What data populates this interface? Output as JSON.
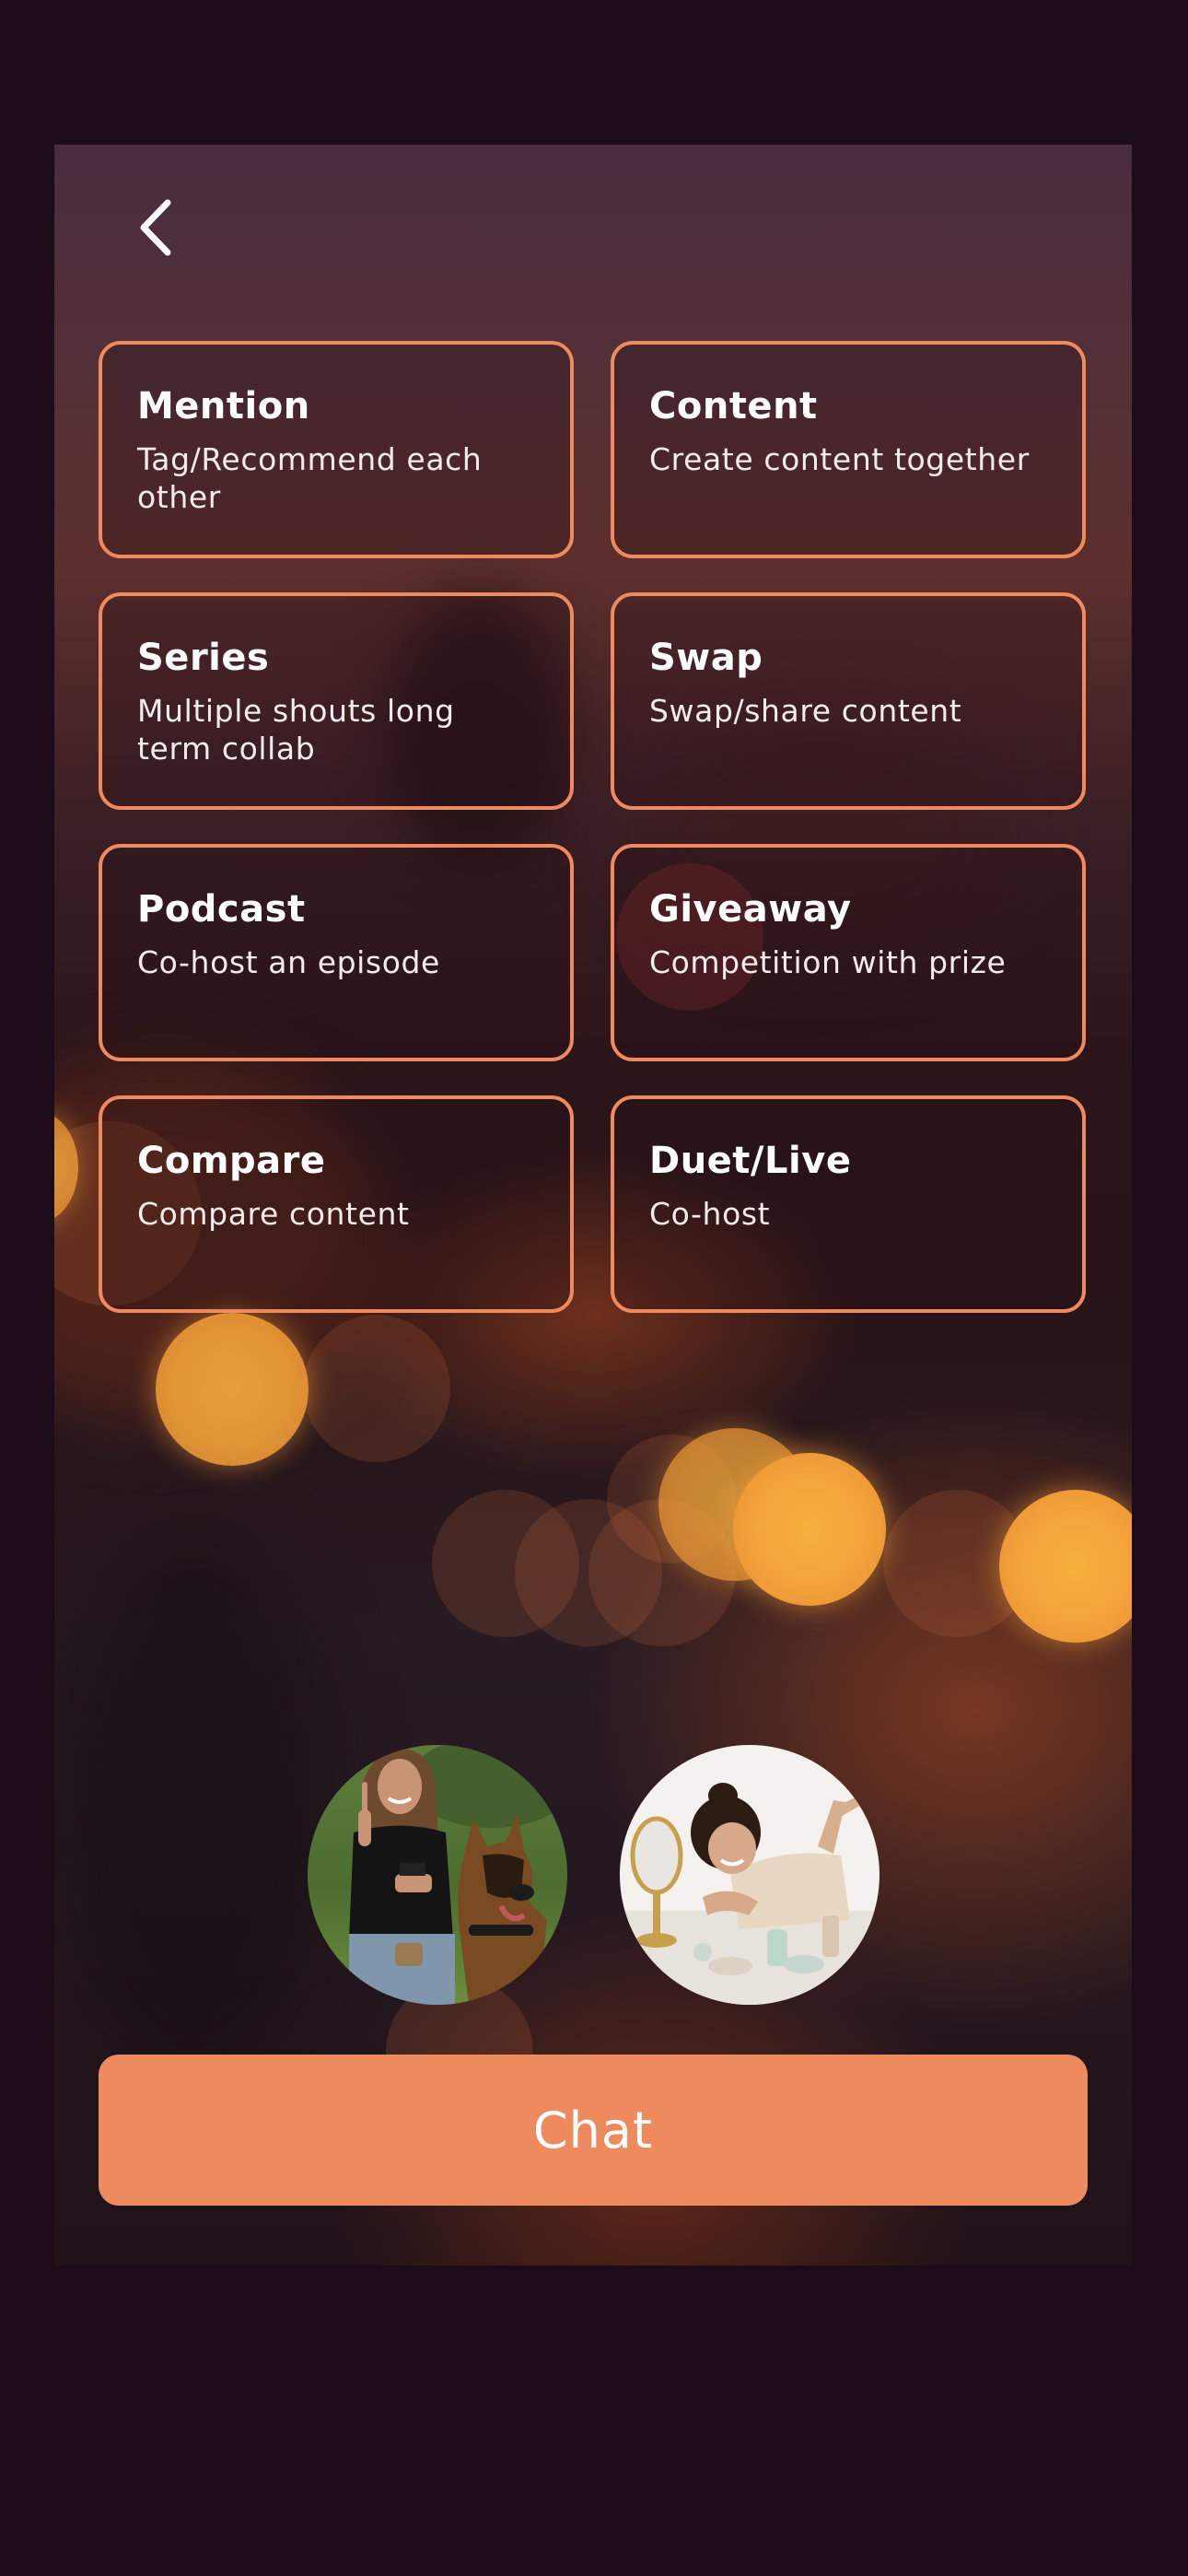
{
  "header": {
    "back_icon": "chevron-left-icon"
  },
  "options": [
    {
      "title": "Mention",
      "description": "Tag/Recommend each other"
    },
    {
      "title": "Content",
      "description": "Create content together"
    },
    {
      "title": "Series",
      "description": "Multiple shouts long term collab"
    },
    {
      "title": "Swap",
      "description": "Swap/share content"
    },
    {
      "title": "Podcast",
      "description": "Co-host an episode"
    },
    {
      "title": "Giveaway",
      "description": "Competition with prize"
    },
    {
      "title": "Compare",
      "description": "Compare content"
    },
    {
      "title": "Duet/Live",
      "description": "Co-host"
    }
  ],
  "avatars": [
    {
      "depicts": "woman-with-dog-photo"
    },
    {
      "depicts": "woman-with-mirror-photo"
    }
  ],
  "chat_button": {
    "label": "Chat"
  },
  "colors": {
    "accent": "#ED8A5E",
    "card_border": "#F08A5D",
    "page_background": "#1C0C19"
  }
}
